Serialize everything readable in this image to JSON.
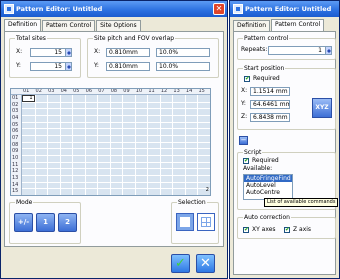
{
  "window1": {
    "title": "Pattern Editor: Untitled",
    "tabs": [
      "Definition",
      "Pattern Control",
      "Site Options"
    ],
    "total_sites": {
      "label": "Total sites",
      "x_label": "X:",
      "x_value": "15",
      "y_label": "Y:",
      "y_value": "15"
    },
    "site_pitch": {
      "label": "Site pitch and FOV overlap",
      "x_label": "X:",
      "x_pitch": "0.810mm",
      "x_overlap": "10.0%",
      "y_label": "Y:",
      "y_pitch": "0.810mm",
      "y_overlap": "10.0%"
    },
    "grid": {
      "columns": [
        "01",
        "02",
        "03",
        "04",
        "05",
        "06",
        "07",
        "08",
        "09",
        "10",
        "11",
        "12",
        "13",
        "14",
        "15"
      ],
      "rows": [
        "01",
        "02",
        "03",
        "04",
        "05",
        "06",
        "07",
        "08",
        "09",
        "10",
        "11",
        "12",
        "13",
        "14",
        "15"
      ],
      "start_cell_label": "1",
      "end_cell_label": "2"
    },
    "mode": {
      "label": "Mode",
      "buttons": [
        "+/-",
        "1",
        "2"
      ]
    },
    "selection": {
      "label": "Selection"
    },
    "ok_icon": "check-icon",
    "cancel_icon": "x-icon"
  },
  "window2": {
    "title": "Pattern Editor: Untitled",
    "tabs": [
      "Definition",
      "Pattern Control"
    ],
    "pattern_control": {
      "label": "Pattern control",
      "repeats_label": "Repeats:",
      "repeats_value": "1"
    },
    "start_position": {
      "label": "Start position",
      "required_label": "Required",
      "x_label": "X:",
      "x_value": "1.1514 mm",
      "y_label": "Y:",
      "y_value": "64.6461 mm",
      "z_label": "Z:",
      "z_value": "6.8438 mm",
      "xyz_button": "XYZ"
    },
    "script": {
      "label": "Script",
      "required_label": "Required",
      "available_label": "Available:",
      "items": [
        "AutoFringeFind",
        "AutoLevel",
        "AutoCentre"
      ],
      "tooltip": "List of available commands"
    },
    "auto_correction": {
      "label": "Auto correction",
      "xy_label": "XY axes",
      "z_label": "Z axis"
    }
  }
}
